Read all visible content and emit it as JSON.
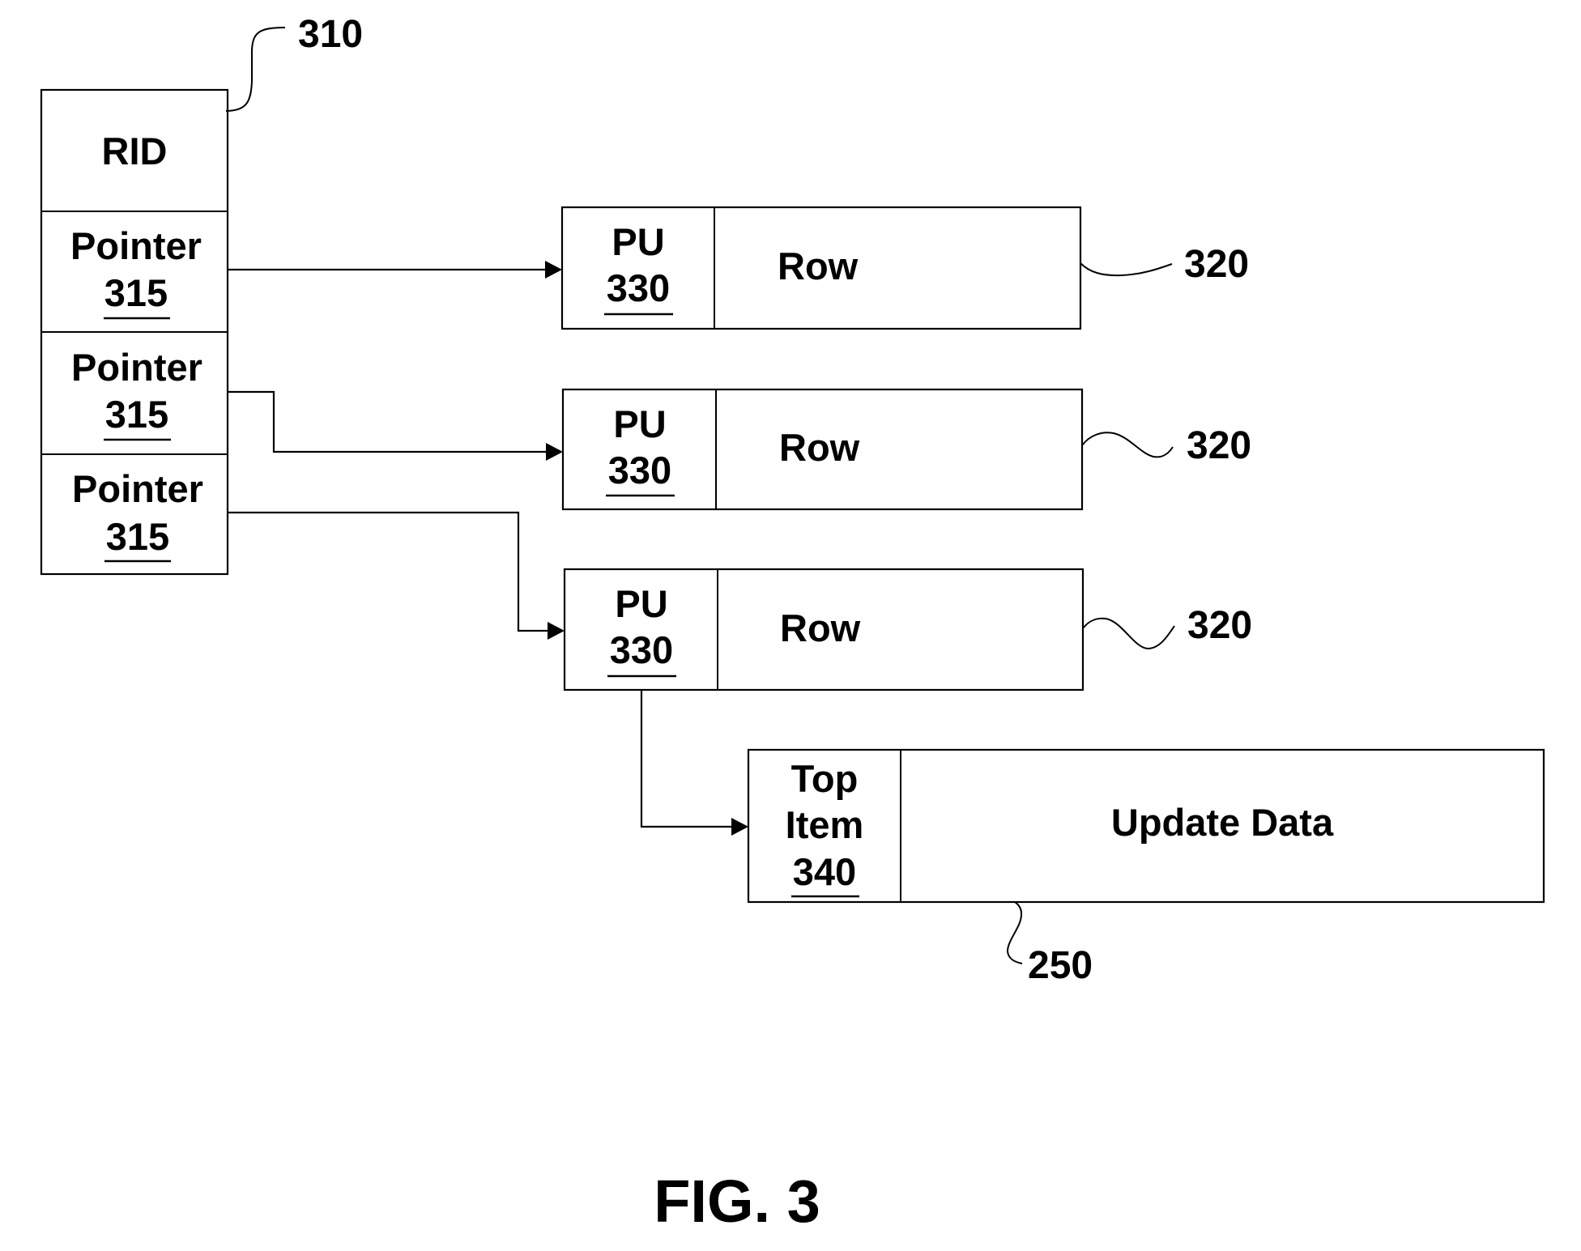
{
  "figure": {
    "caption": "FIG. 3"
  },
  "record_structure": {
    "ref": "310",
    "rid_label": "RID",
    "pointers": [
      {
        "label": "Pointer",
        "ref": "315"
      },
      {
        "label": "Pointer",
        "ref": "315"
      },
      {
        "label": "Pointer",
        "ref": "315"
      }
    ]
  },
  "rows": [
    {
      "pu_label": "PU",
      "pu_ref": "330",
      "row_label": "Row",
      "ref": "320"
    },
    {
      "pu_label": "PU",
      "pu_ref": "330",
      "row_label": "Row",
      "ref": "320"
    },
    {
      "pu_label": "PU",
      "pu_ref": "330",
      "row_label": "Row",
      "ref": "320"
    }
  ],
  "update_item": {
    "top_line1": "Top",
    "top_line2": "Item",
    "top_ref": "340",
    "data_label": "Update Data",
    "ref": "250"
  },
  "connections": [
    {
      "from": "pointer-1",
      "to": "row-1"
    },
    {
      "from": "pointer-2",
      "to": "row-2"
    },
    {
      "from": "pointer-3",
      "to": "row-3"
    },
    {
      "from": "row-3-pu",
      "to": "update-item"
    }
  ],
  "colors": {
    "ink": "#000000",
    "paper": "#ffffff"
  }
}
